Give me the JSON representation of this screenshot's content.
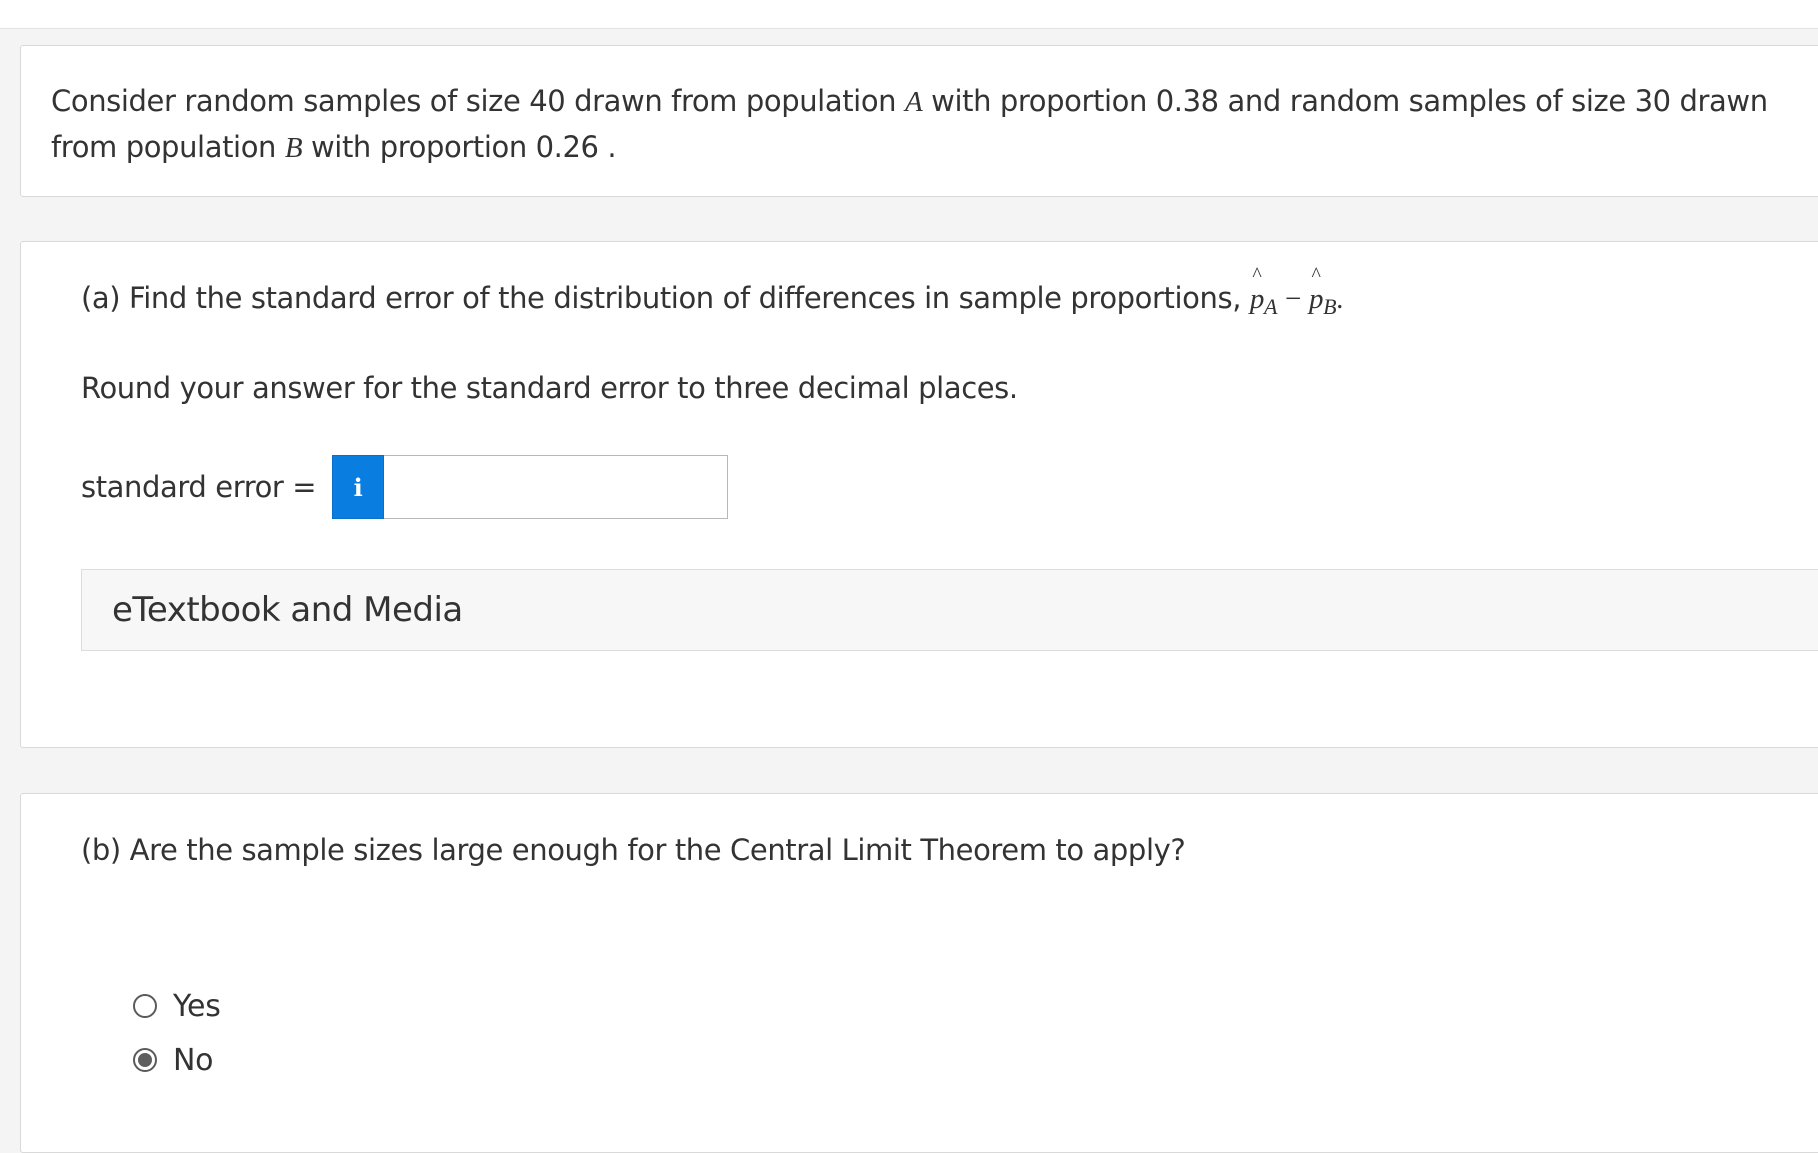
{
  "intro": {
    "part1": "Consider random samples of size 40 drawn from population ",
    "varA": "A",
    "part2": " with proportion 0.38 and random samples of size 30 drawn from population ",
    "varB": "B",
    "part3": " with proportion 0.26 ."
  },
  "question_a": {
    "title": "(a) Find the standard error of the distribution of differences in sample proportions, ",
    "p_symbol": "p",
    "hat": "^",
    "sub_a": "A",
    "minus": "−",
    "sub_b": "B",
    "end": ".",
    "instruction": "Round your answer for the standard error to three decimal places.",
    "input_label": "standard error =",
    "info_icon_text": "i",
    "input_value": "",
    "etextbook_label": "eTextbook and Media"
  },
  "question_b": {
    "title": "(b) Are the sample sizes large enough for the Central Limit Theorem to apply?",
    "options": [
      {
        "label": "Yes",
        "selected": false
      },
      {
        "label": "No",
        "selected": true
      }
    ]
  },
  "colors": {
    "accent": "#0a7ee0",
    "text": "#333333",
    "page_bg": "#f4f4f4"
  }
}
